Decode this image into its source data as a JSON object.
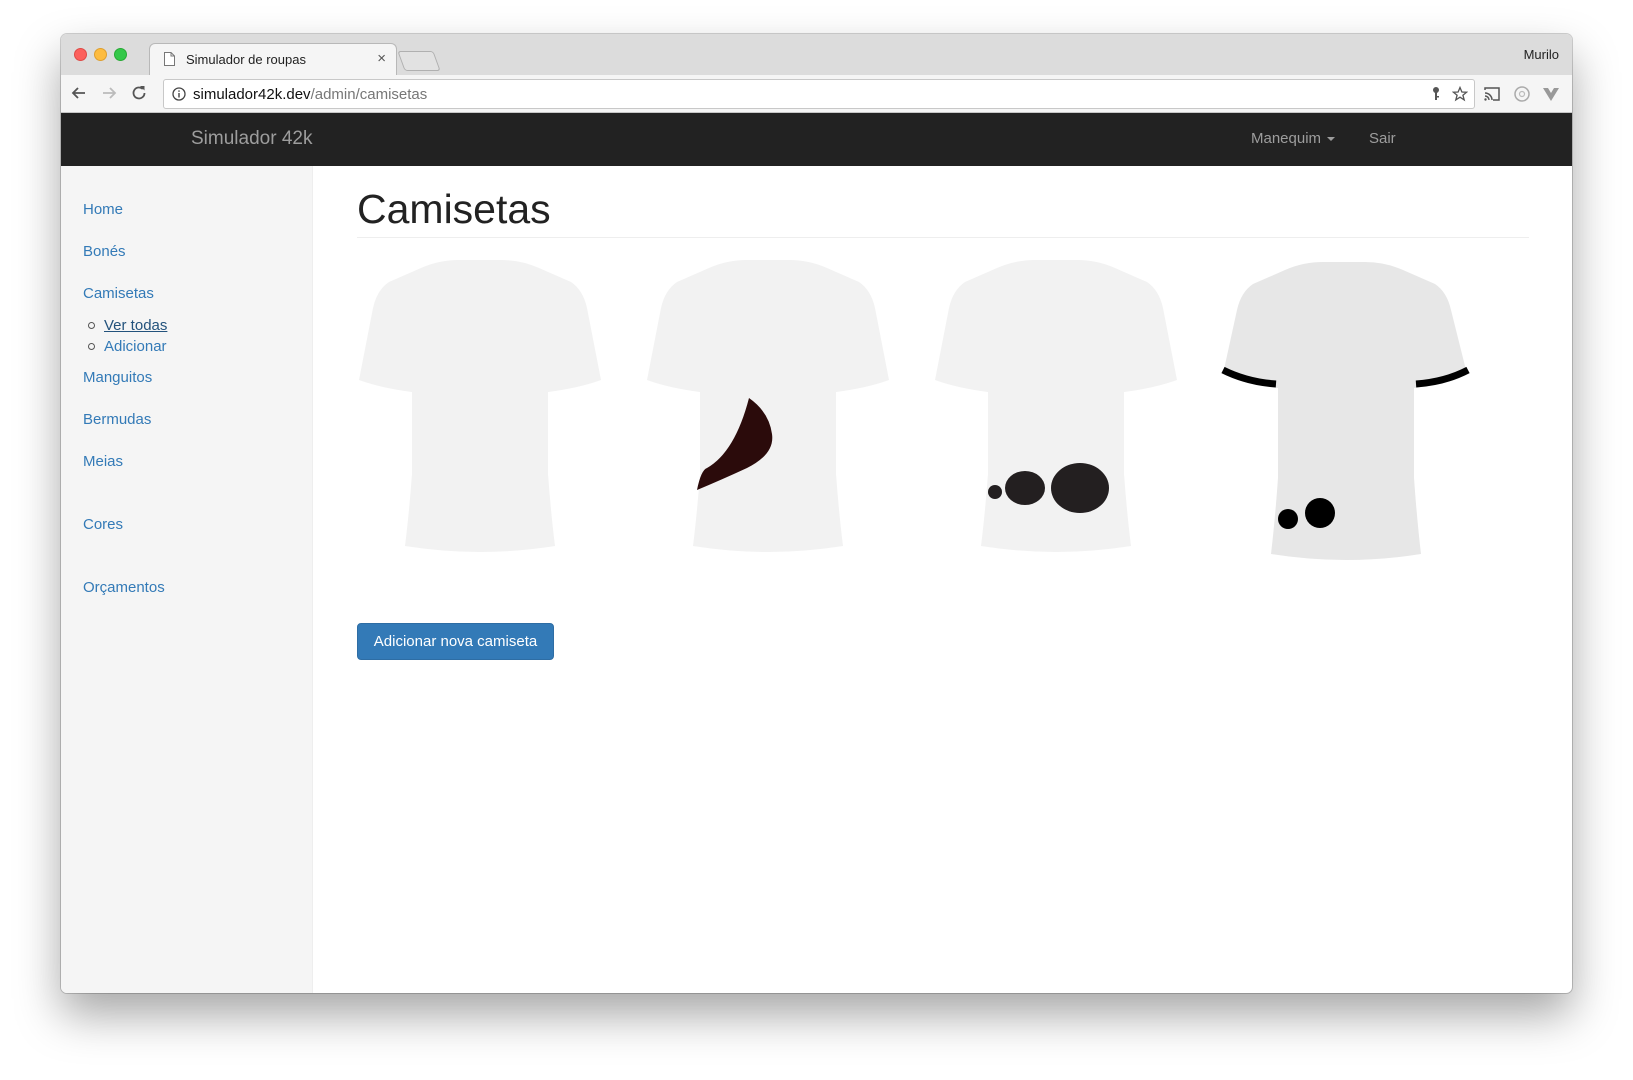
{
  "browser": {
    "tab_title": "Simulador de roupas",
    "tab_close": "×",
    "profile_name": "Murilo",
    "url_host": "simulador42k.dev",
    "url_path": "/admin/camisetas"
  },
  "navbar": {
    "brand": "Simulador 42k",
    "dropdown_label": "Manequim",
    "logout_label": "Sair"
  },
  "sidebar": {
    "items": [
      {
        "label": "Home"
      },
      {
        "label": "Bonés"
      },
      {
        "label": "Camisetas"
      },
      {
        "label": "Manguitos"
      },
      {
        "label": "Bermudas"
      },
      {
        "label": "Meias"
      },
      {
        "label": "Cores"
      },
      {
        "label": "Orçamentos"
      }
    ],
    "camisetas_sub": [
      {
        "label": "Ver todas",
        "active": true
      },
      {
        "label": "Adicionar",
        "active": false
      }
    ]
  },
  "main": {
    "title": "Camisetas",
    "add_button": "Adicionar nova camiseta",
    "shirts": [
      {
        "design": "plain",
        "body_color": "#f2f2f2"
      },
      {
        "design": "swoosh",
        "body_color": "#f2f2f2",
        "accent_color": "#2b0b0b"
      },
      {
        "design": "bubbles",
        "body_color": "#f2f2f2",
        "accent_color": "#231f20"
      },
      {
        "design": "sleeve-stripes-dots",
        "body_color": "#e7e7e7",
        "accent_color": "#000000"
      }
    ]
  },
  "colors": {
    "navbar_bg": "#222222",
    "link": "#337ab7",
    "primary_button": "#337ab7",
    "sidebar_bg": "#f5f5f5"
  }
}
